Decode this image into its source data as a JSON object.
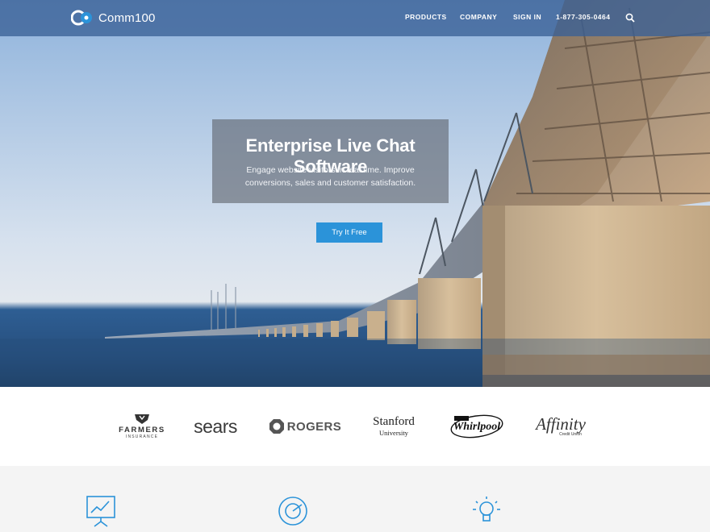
{
  "brand": {
    "name": "Comm100"
  },
  "nav": {
    "items": [
      {
        "label": "PRODUCTS"
      },
      {
        "label": "COMPANY"
      },
      {
        "label": "SIGN IN"
      },
      {
        "label": "1-877-305-0464"
      }
    ],
    "search_icon": "search-icon"
  },
  "hero": {
    "title": "Enterprise Live Chat Software",
    "subtitle": "Engage website visitors in real time. Improve conversions, sales and customer satisfaction.",
    "cta_label": "Try It Free"
  },
  "clients": {
    "farmers": {
      "name": "FARMERS",
      "sub": "INSURANCE"
    },
    "sears": {
      "name": "sears"
    },
    "rogers": {
      "name": "ROGERS"
    },
    "stanford": {
      "name": "Stanford",
      "sub": "University"
    },
    "whirlpool": {
      "name": "Whirlpool"
    },
    "affinity": {
      "name": "Affinity",
      "sub": "Credit Union"
    }
  },
  "features": {
    "icons": [
      "presentation-chart-icon",
      "chart-ring-icon",
      "lightbulb-icon"
    ]
  },
  "colors": {
    "nav_bg": "#3a6096",
    "cta": "#2b93d9",
    "feature_icon": "#2b93d9",
    "features_bg": "#f4f4f4"
  }
}
